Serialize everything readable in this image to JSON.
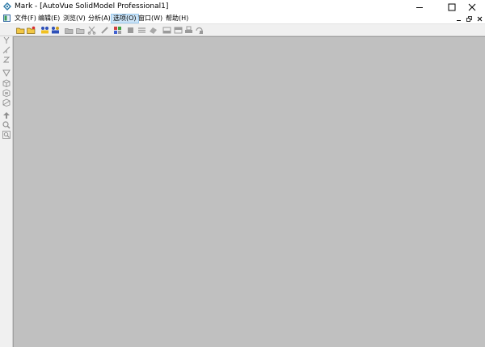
{
  "window": {
    "title": "Mark - [AutoVue SolidModel Professional1]",
    "controls": [
      "minimize-icon",
      "maximize-icon",
      "close-icon"
    ]
  },
  "menu": {
    "items": [
      {
        "label": "文件(F)"
      },
      {
        "label": "编辑(E)"
      },
      {
        "label": "浏览(V)"
      },
      {
        "label": "分析(A)"
      },
      {
        "label": "选项(O)"
      },
      {
        "label": "窗口(W)"
      },
      {
        "label": "帮助(H)"
      }
    ],
    "active_item": "选项(O)",
    "mdi_controls": [
      "mdi-minimize-icon",
      "mdi-restore-icon",
      "mdi-close-icon"
    ]
  },
  "toolbar": {
    "buttons": [
      {
        "icon": "open-folder-icon",
        "enabled": true
      },
      {
        "icon": "open-folder-star-icon",
        "enabled": true
      },
      {
        "icon": "markup-people-icon",
        "enabled": true
      },
      {
        "icon": "markup-people-alt-icon",
        "enabled": true
      },
      {
        "icon": "folder-gray-icon",
        "enabled": false
      },
      {
        "icon": "folder-gray-alt-icon",
        "enabled": false
      },
      {
        "icon": "scissors-icon",
        "enabled": false
      },
      {
        "icon": "pencil-icon",
        "enabled": false
      },
      {
        "icon": "panel-icon",
        "enabled": false
      },
      {
        "icon": "palette-icon",
        "enabled": true
      },
      {
        "icon": "layers-icon",
        "enabled": false
      },
      {
        "icon": "eraser-icon",
        "enabled": false
      },
      {
        "icon": "frame-icon",
        "enabled": false
      },
      {
        "icon": "frame-alt-icon",
        "enabled": false
      },
      {
        "icon": "print-icon",
        "enabled": false
      },
      {
        "icon": "rotate-icon",
        "enabled": false
      }
    ]
  },
  "left_toolbar": {
    "buttons": [
      {
        "icon": "axis-y-icon"
      },
      {
        "icon": "axis-xy-icon"
      },
      {
        "icon": "axis-z-icon"
      },
      {
        "icon": "cone-icon"
      },
      {
        "icon": "cube-icon"
      },
      {
        "icon": "cube-section-icon"
      },
      {
        "icon": "cube-alt-icon"
      },
      {
        "icon": "arrow-up-icon"
      },
      {
        "icon": "zoom-icon"
      },
      {
        "icon": "zoom-window-icon"
      }
    ]
  },
  "colors": {
    "workspace": "#c0c0c0",
    "menu_active": "#cce4f7",
    "toolbar_bg": "#f0f0f0"
  }
}
